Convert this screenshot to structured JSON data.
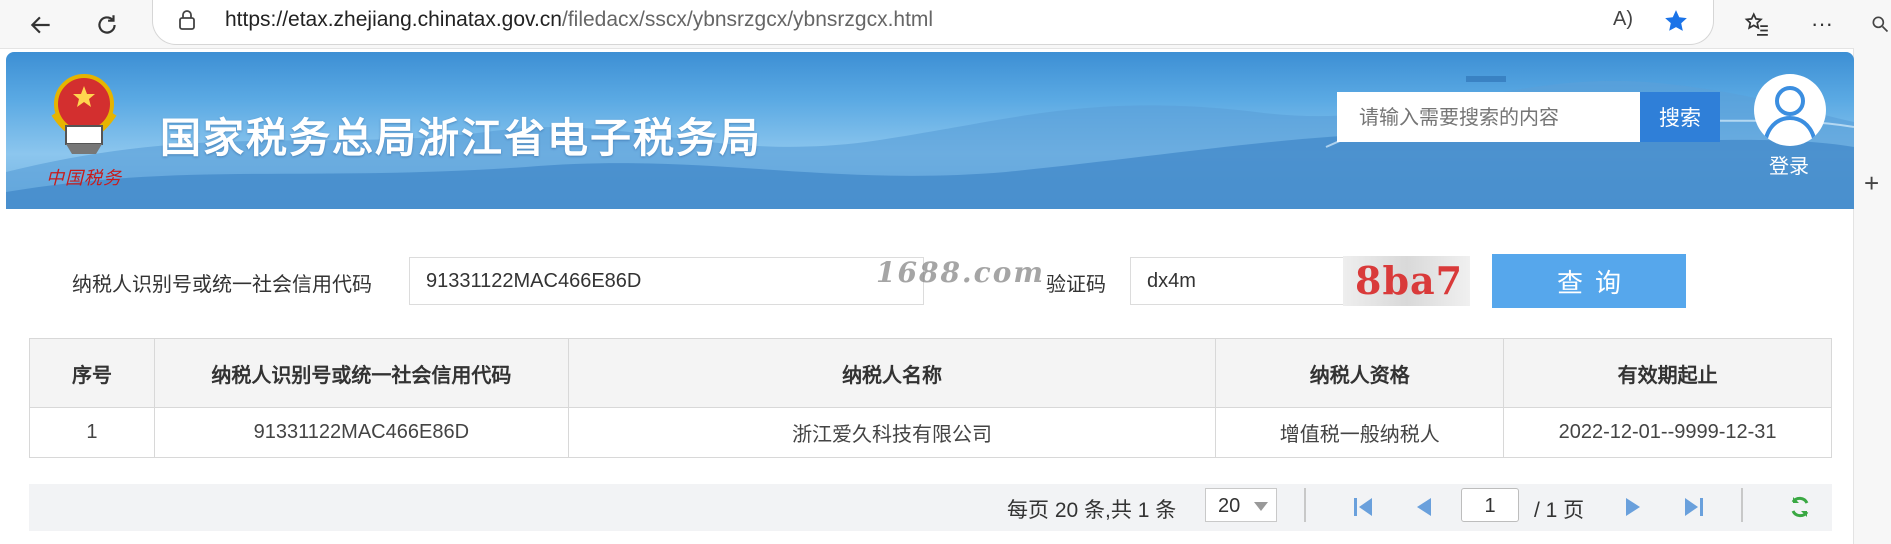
{
  "browser": {
    "url_host": "https://etax.zhejiang.chinatax.gov.cn",
    "url_path": "/filedacx/sscx/ybnsrzgcx/ybnsrzgcx.html",
    "read_aloud_label": "A)",
    "more_label": "···",
    "new_tab_label": "+"
  },
  "header": {
    "title": "国家税务总局浙江省电子税务局",
    "emblem_caption": "中国税务",
    "search_placeholder": "请输入需要搜索的内容",
    "search_button": "搜索",
    "login_label": "登录"
  },
  "form": {
    "taxpayer_id_label": "纳税人识别号或统一社会信用代码",
    "taxpayer_id_value": "91331122MAC466E86D",
    "captcha_label": "验证码",
    "captcha_value": "dx4m",
    "captcha_image_text": "8ba7",
    "query_button": "查询",
    "watermark": "1688.com"
  },
  "table": {
    "headers": [
      "序号",
      "纳税人识别号或统一社会信用代码",
      "纳税人名称",
      "纳税人资格",
      "有效期起止"
    ],
    "rows": [
      [
        "1",
        "91331122MAC466E86D",
        "浙江爱久科技有限公司",
        "增值税一般纳税人",
        "2022-12-01--9999-12-31"
      ]
    ]
  },
  "pager": {
    "summary": "每页 20 条,共 1 条",
    "page_size": "20",
    "current_page": "1",
    "total_pages": "/ 1 页"
  },
  "colors": {
    "accent_blue": "#2f7fd8",
    "query_button": "#56a7ec",
    "captcha_red": "#d93a3a",
    "pager_icon": "#6aa0dc",
    "refresh_green": "#3aa843"
  }
}
